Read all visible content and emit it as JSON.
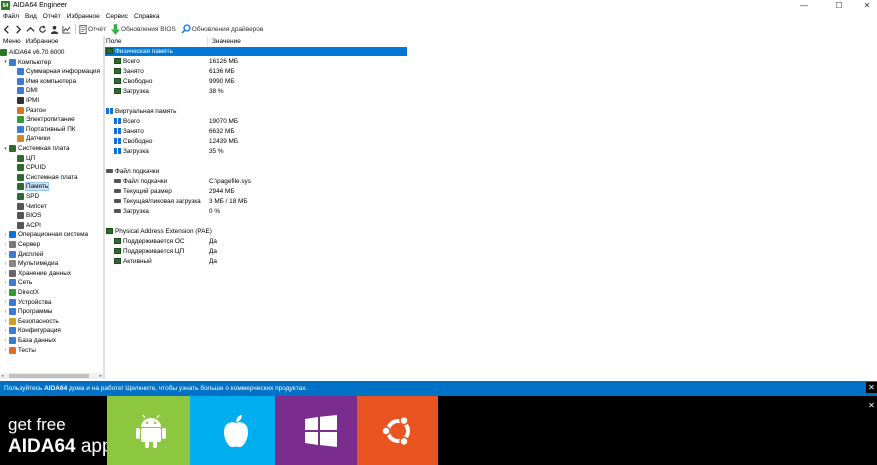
{
  "window": {
    "app_logo": "64",
    "title": "AIDA64 Engineer",
    "minimize": "—",
    "maximize": "☐",
    "close": "✕"
  },
  "menu": [
    "Файл",
    "Вид",
    "Отчёт",
    "Избранное",
    "Сервис",
    "Справка"
  ],
  "toolbar": {
    "report": "Отчёт",
    "bios_updates": "Обновления BIOS",
    "driver_updates": "Обновления драйверов"
  },
  "tabs": [
    "Меню",
    "Избранное"
  ],
  "tree": [
    {
      "label": "AIDA64 v6.70.6000",
      "icon": "aida-logo-icon",
      "color": "#2b7a2b"
    },
    {
      "label": "Компьютер",
      "icon": "computer-icon",
      "color": "#3a7bd5"
    },
    {
      "label": "Суммарная информация",
      "icon": "summary-icon",
      "color": "#3a7bd5"
    },
    {
      "label": "Имя компьютера",
      "icon": "computer-name-icon",
      "color": "#3a7bd5"
    },
    {
      "label": "DMI",
      "icon": "dmi-icon",
      "color": "#3a7bd5"
    },
    {
      "label": "IPMI",
      "icon": "ipmi-icon",
      "color": "#333333"
    },
    {
      "label": "Разгон",
      "icon": "overclock-icon",
      "color": "#e07020"
    },
    {
      "label": "Электропитание",
      "icon": "power-icon",
      "color": "#2e9e2e"
    },
    {
      "label": "Портативный ПК",
      "icon": "laptop-icon",
      "color": "#3a7bd5"
    },
    {
      "label": "Датчики",
      "icon": "sensor-icon",
      "color": "#d08a20"
    },
    {
      "label": "Системная плата",
      "icon": "motherboard-icon",
      "color": "#2e6b2e"
    },
    {
      "label": "ЦП",
      "icon": "cpu-icon",
      "color": "#2e6b2e"
    },
    {
      "label": "CPUID",
      "icon": "cpuid-icon",
      "color": "#2e6b2e"
    },
    {
      "label": "Системная плата",
      "icon": "board-icon",
      "color": "#2e6b2e"
    },
    {
      "label": "Память",
      "icon": "memory-icon",
      "color": "#2e6b2e"
    },
    {
      "label": "SPD",
      "icon": "spd-icon",
      "color": "#2e6b2e"
    },
    {
      "label": "Чипсет",
      "icon": "chipset-icon",
      "color": "#555555"
    },
    {
      "label": "BIOS",
      "icon": "bios-icon",
      "color": "#555555"
    },
    {
      "label": "ACPI",
      "icon": "acpi-icon",
      "color": "#555555"
    },
    {
      "label": "Операционная система",
      "icon": "os-icon",
      "color": "#0a74da"
    },
    {
      "label": "Сервер",
      "icon": "server-icon",
      "color": "#777777"
    },
    {
      "label": "Дисплей",
      "icon": "display-icon",
      "color": "#3a7bd5"
    },
    {
      "label": "Мультимедиа",
      "icon": "multimedia-icon",
      "color": "#888888"
    },
    {
      "label": "Хранение данных",
      "icon": "storage-icon",
      "color": "#666666"
    },
    {
      "label": "Сеть",
      "icon": "network-icon",
      "color": "#3a7bd5"
    },
    {
      "label": "DirectX",
      "icon": "directx-icon",
      "color": "#2e9e2e"
    },
    {
      "label": "Устройства",
      "icon": "devices-icon",
      "color": "#3a7bd5"
    },
    {
      "label": "Программы",
      "icon": "programs-icon",
      "color": "#3a7bd5"
    },
    {
      "label": "Безопасность",
      "icon": "security-icon",
      "color": "#d0a020"
    },
    {
      "label": "Конфигурация",
      "icon": "config-icon",
      "color": "#3a7bd5"
    },
    {
      "label": "База данных",
      "icon": "database-icon",
      "color": "#3a7bd5"
    },
    {
      "label": "Тесты",
      "icon": "tests-icon",
      "color": "#e07020"
    }
  ],
  "columns": {
    "field": "Поле",
    "value": "Значение"
  },
  "rows": [
    {
      "field": "Физическая память",
      "value": "",
      "kind": "section",
      "icon": "memory-icon"
    },
    {
      "field": "Всего",
      "value": "16126 МБ",
      "kind": "item",
      "icon": "memory-icon"
    },
    {
      "field": "Занято",
      "value": "6136 МБ",
      "kind": "item",
      "icon": "memory-icon"
    },
    {
      "field": "Свободно",
      "value": "9990 МБ",
      "kind": "item",
      "icon": "memory-icon"
    },
    {
      "field": "Загрузка",
      "value": "38 %",
      "kind": "item",
      "icon": "memory-icon"
    },
    {
      "field": "Виртуальная память",
      "value": "",
      "kind": "section",
      "icon": "windows-icon"
    },
    {
      "field": "Всего",
      "value": "19070 МБ",
      "kind": "item",
      "icon": "windows-icon"
    },
    {
      "field": "Занято",
      "value": "6632 МБ",
      "kind": "item",
      "icon": "windows-icon"
    },
    {
      "field": "Свободно",
      "value": "12439 МБ",
      "kind": "item",
      "icon": "windows-icon"
    },
    {
      "field": "Загрузка",
      "value": "35 %",
      "kind": "item",
      "icon": "windows-icon"
    },
    {
      "field": "Файл подкачки",
      "value": "",
      "kind": "section",
      "icon": "drive-icon"
    },
    {
      "field": "Файл подкачки",
      "value": "C:\\pagefile.sys",
      "kind": "item",
      "icon": "drive-icon"
    },
    {
      "field": "Текущий размер",
      "value": "2944 МБ",
      "kind": "item",
      "icon": "drive-icon"
    },
    {
      "field": "Текущая/пиковая загрузка",
      "value": "3 МБ / 18 МБ",
      "kind": "item",
      "icon": "drive-icon"
    },
    {
      "field": "Загрузка",
      "value": "0 %",
      "kind": "item",
      "icon": "drive-icon"
    },
    {
      "field": "Physical Address Extension (PAE)",
      "value": "",
      "kind": "section",
      "icon": "memory-icon"
    },
    {
      "field": "Поддерживается ОС",
      "value": "Да",
      "kind": "item",
      "icon": "memory-icon"
    },
    {
      "field": "Поддерживается ЦП",
      "value": "Да",
      "kind": "item",
      "icon": "memory-icon"
    },
    {
      "field": "Активный",
      "value": "Да",
      "kind": "item",
      "icon": "memory-icon"
    }
  ],
  "notice": {
    "prefix": "Пользуйтесь ",
    "brand": "AIDA64",
    "suffix": " дома и на работе! Щелкните, чтобы узнать больше о коммерческих продуктах."
  },
  "banner": {
    "get_free": "get free",
    "brand": "AIDA64",
    "app": " app",
    "tiles": [
      {
        "name": "android-icon",
        "color": "#8dc63f"
      },
      {
        "name": "apple-icon",
        "color": "#00aeef"
      },
      {
        "name": "windows-icon",
        "color": "#7b2d8e"
      },
      {
        "name": "ubuntu-icon",
        "color": "#e95420"
      }
    ]
  }
}
